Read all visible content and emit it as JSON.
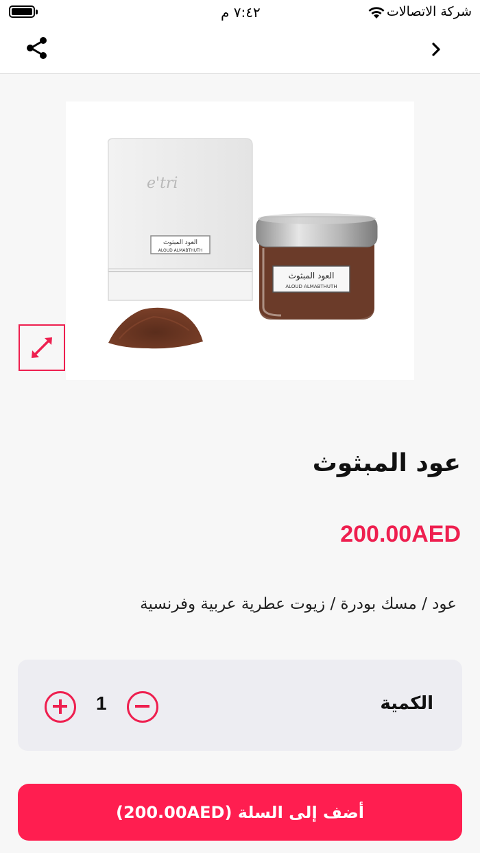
{
  "status_bar": {
    "carrier": "شركة الاتصالات",
    "time": "٧:٤٢ م"
  },
  "nav": {
    "share_icon": "share-icon",
    "back_icon": "chevron-right-icon"
  },
  "product": {
    "image_brand": "e'tri",
    "image_label_ar": "العود المبثوث",
    "image_label_en": "ALOUD ALMABTHUTH",
    "title": "عود المبثوث",
    "price": "200.00AED",
    "description": "عود / مسك بودرة / زيوت عطرية عربية وفرنسية"
  },
  "quantity": {
    "label": "الكمية",
    "value": "1"
  },
  "cart": {
    "button_label": "أضف إلى السلة (200.00AED)"
  },
  "colors": {
    "accent": "#ee1f4f",
    "button": "#ff1e50"
  }
}
